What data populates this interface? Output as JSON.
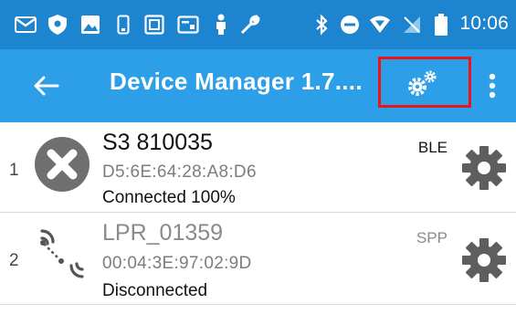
{
  "status_bar": {
    "time": "10:06",
    "icons": [
      "gmail-icon",
      "shield-icon",
      "image-icon",
      "sim-icon",
      "keyboard-icon",
      "cast-icon",
      "person-icon",
      "wrench-icon",
      "bluetooth-icon",
      "do-not-disturb-icon",
      "wifi-icon",
      "no-signal-icon",
      "battery-icon"
    ]
  },
  "app_bar": {
    "title": "Device Manager 1.7....",
    "back_icon": "arrow-left-icon",
    "settings_icon": "gears-icon",
    "overflow_icon": "more-vert-icon",
    "highlight_color": "#e8161b"
  },
  "devices": [
    {
      "index": "1",
      "name": "S3 810035",
      "mac": "D5:6E:64:28:A8:D6",
      "status": "Connected 100%",
      "protocol": "BLE",
      "icon": "close-circle-icon",
      "name_color": "#111111",
      "protocol_color": "#111111"
    },
    {
      "index": "2",
      "name": "LPR_01359",
      "mac": "00:04:3E:97:02:9D",
      "status": "Disconnected",
      "protocol": "SPP",
      "icon": "wireless-signal-icon",
      "name_color": "#8a8a8a",
      "protocol_color": "#8a8a8a"
    }
  ],
  "colors": {
    "status_bar": "#1d84cf",
    "app_bar": "#2d9ee8"
  }
}
